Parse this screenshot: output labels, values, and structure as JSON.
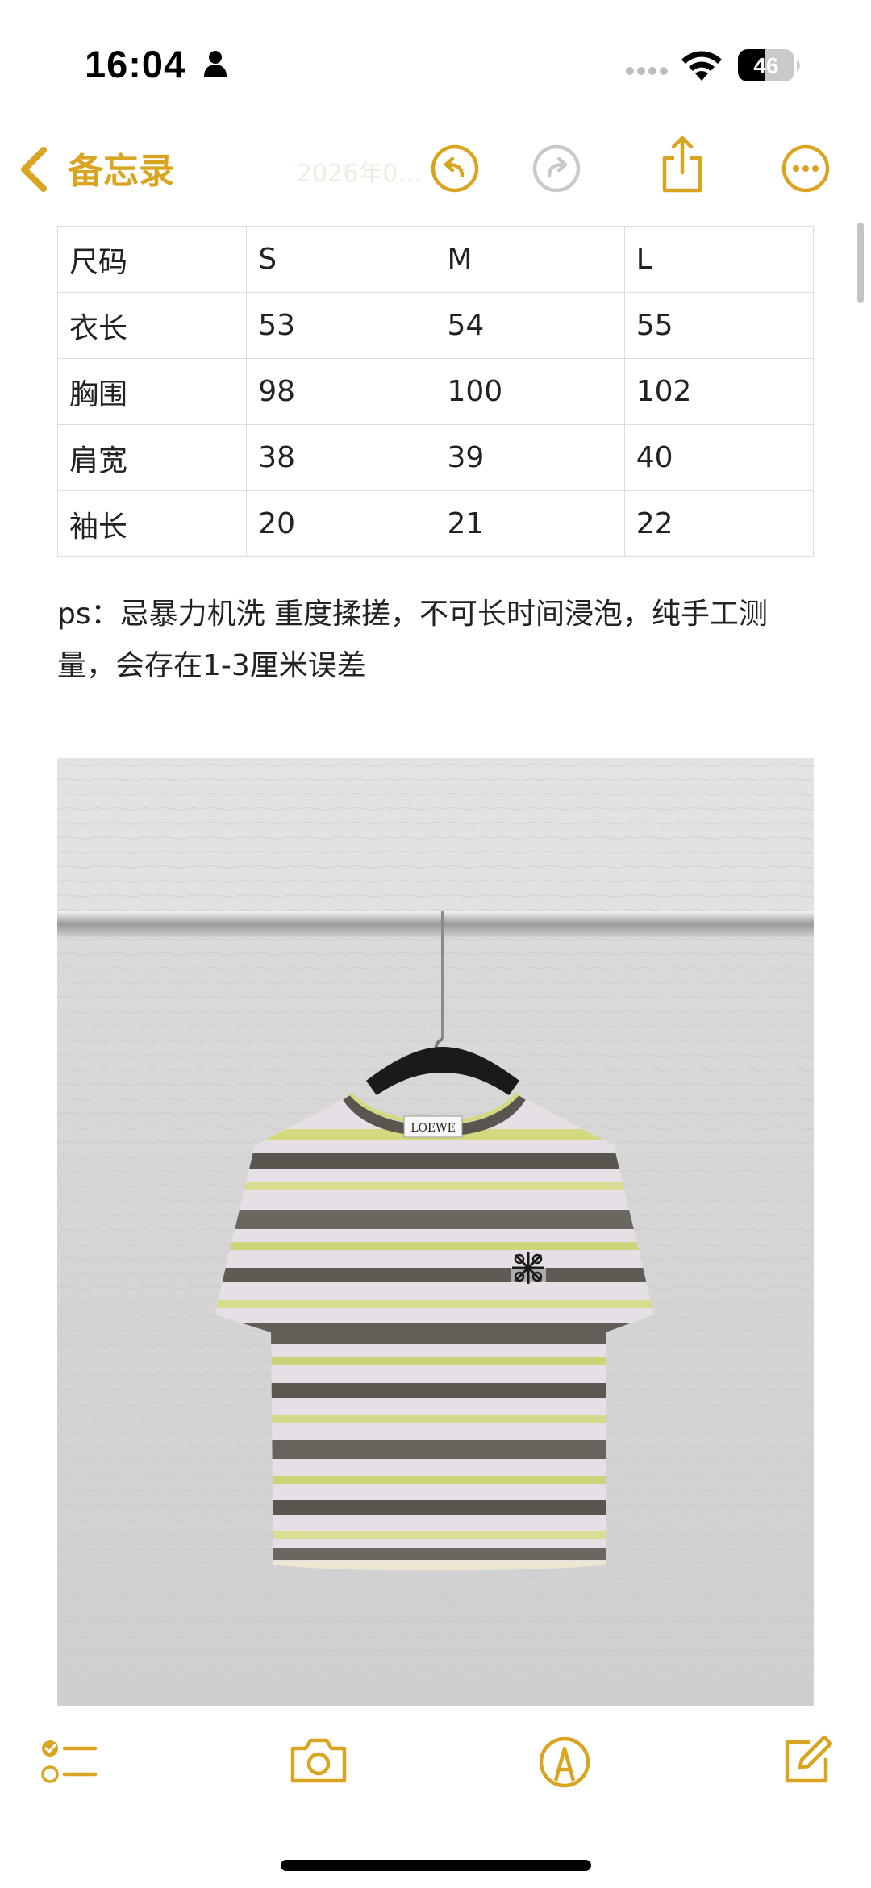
{
  "status_bar": {
    "time": "16:04",
    "battery_level": "46",
    "icons": [
      "person-icon",
      "signal-dots",
      "wifi-icon",
      "battery-icon"
    ]
  },
  "nav": {
    "back_label": "备忘录",
    "faded_title": "2026年0…",
    "icons": [
      "undo-icon",
      "redo-icon",
      "share-icon",
      "more-icon"
    ],
    "accent": "#d9a521"
  },
  "size_table": {
    "rows": [
      [
        "尺码",
        "S",
        "M",
        "L"
      ],
      [
        "衣长",
        "53",
        "54",
        "55"
      ],
      [
        "胸围",
        "98",
        "100",
        "102"
      ],
      [
        "肩宽",
        "38",
        "39",
        "40"
      ],
      [
        "袖长",
        "20",
        "21",
        "22"
      ]
    ]
  },
  "note": {
    "text": "ps：忌暴力机洗 重度揉搓，不可长时间浸泡，纯手工测量，会存在1-3厘米误差"
  },
  "photo": {
    "label_text": "LOEWE"
  },
  "toolbar": {
    "icons": [
      "checklist-icon",
      "camera-icon",
      "markup-icon",
      "compose-icon"
    ]
  }
}
